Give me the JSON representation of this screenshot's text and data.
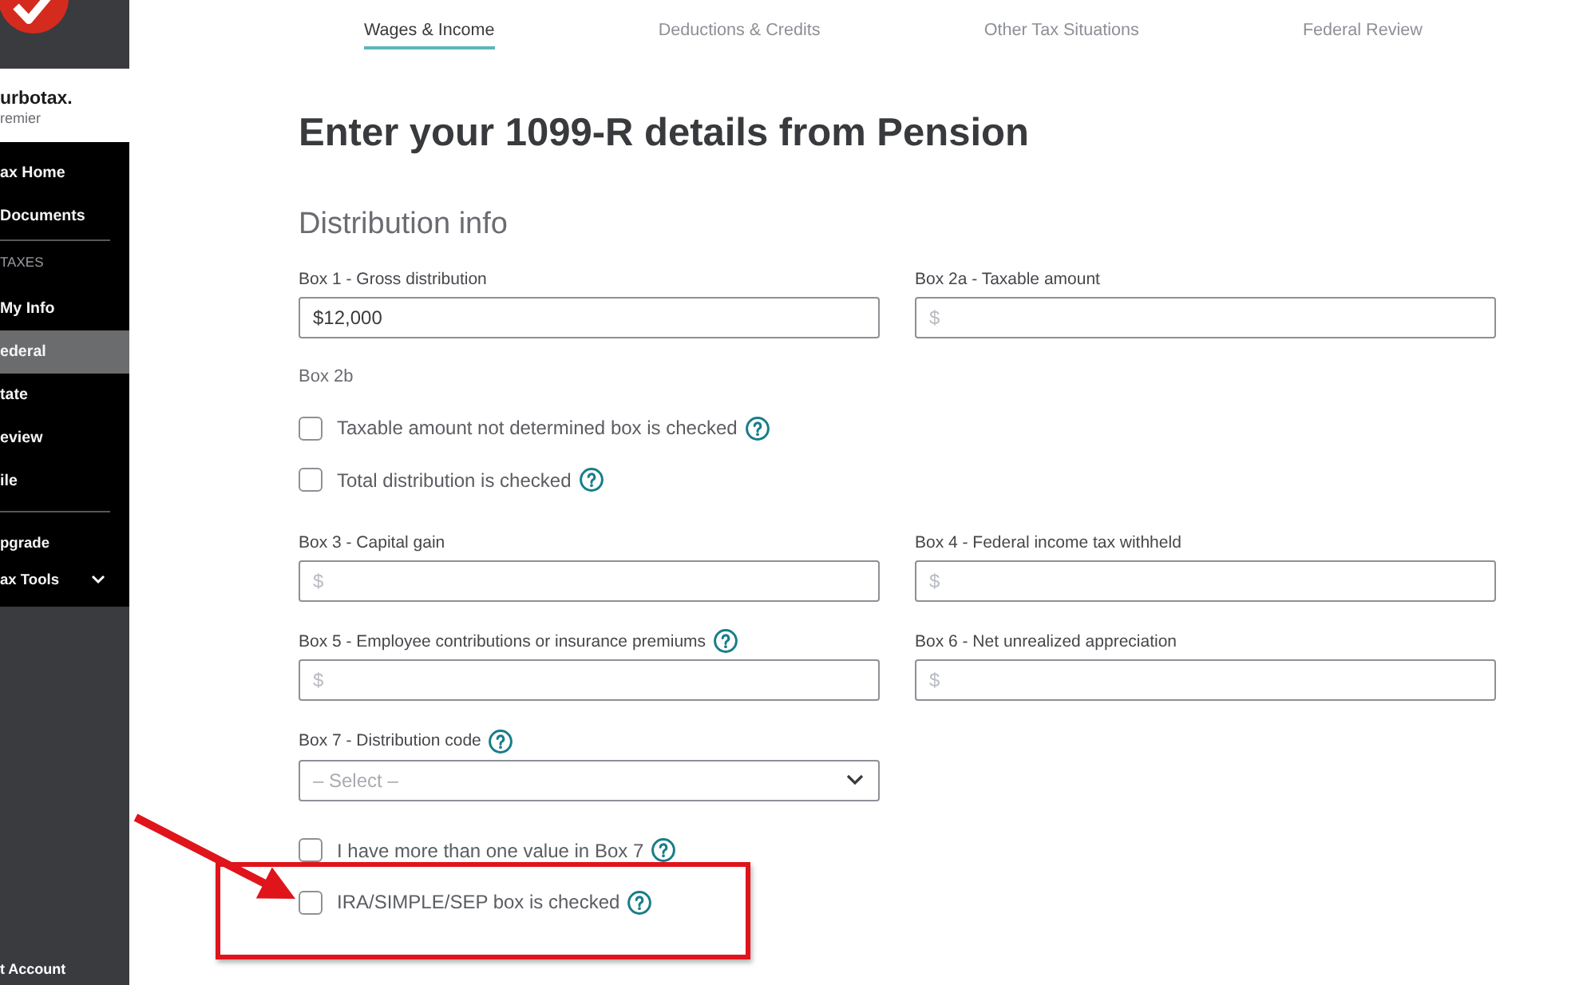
{
  "sidebar": {
    "logo": {
      "wordmark": "urbotax.",
      "edition": "remier"
    },
    "groups": [
      {
        "kind": "primary",
        "items": [
          {
            "label": "ax Home",
            "selected": false
          },
          {
            "label": "Documents",
            "selected": false
          }
        ]
      },
      {
        "kind": "primary",
        "header": "TAXES",
        "items": [
          {
            "label": "My Info",
            "selected": false
          },
          {
            "label": "ederal",
            "selected": true
          },
          {
            "label": "tate",
            "selected": false
          },
          {
            "label": "eview",
            "selected": false
          },
          {
            "label": "ile",
            "selected": false
          }
        ]
      },
      {
        "kind": "secondary",
        "items": [
          {
            "label": "pgrade",
            "selected": false
          },
          {
            "label": "ax Tools",
            "selected": false,
            "expanded": false
          }
        ]
      }
    ],
    "account": "t Account"
  },
  "tabs": [
    {
      "label": "Wages & Income",
      "selected": true
    },
    {
      "label": "Deductions & Credits",
      "selected": false
    },
    {
      "label": "Other Tax Situations",
      "selected": false
    },
    {
      "label": "Federal Review",
      "selected": false
    }
  ],
  "page": {
    "title": "Enter your 1099-R details from Pension",
    "section": "Distribution info"
  },
  "form": [
    {
      "kind": "fields",
      "fields": [
        {
          "kind": "text",
          "label": "Box 1 - Gross distribution",
          "value": "$12,000"
        },
        {
          "kind": "text",
          "label": "Box 2a - Taxable amount",
          "placeholder": "$"
        }
      ]
    },
    {
      "kind": "note",
      "text": "Box 2b"
    },
    {
      "kind": "checkbox",
      "label": "Taxable amount not determined box is checked",
      "checked": false,
      "help": true
    },
    {
      "kind": "checkbox",
      "label": "Total distribution is checked",
      "checked": false,
      "help": true
    },
    {
      "kind": "fields",
      "fields": [
        {
          "kind": "text",
          "label": "Box 3 - Capital gain",
          "placeholder": "$"
        },
        {
          "kind": "text",
          "label": "Box 4 - Federal income tax withheld",
          "placeholder": "$"
        }
      ]
    },
    {
      "kind": "fields",
      "fields": [
        {
          "kind": "text",
          "label": "Box 5 - Employee contributions or insurance premiums",
          "placeholder": "$",
          "help": true
        },
        {
          "kind": "text",
          "label": "Box 6 - Net unrealized appreciation",
          "placeholder": "$"
        }
      ]
    },
    {
      "kind": "fields",
      "fields": [
        {
          "kind": "select",
          "label": "Box 7 - Distribution code",
          "placeholder": "– Select –",
          "help": true
        }
      ]
    },
    {
      "kind": "checkbox",
      "label": "I have more than one value in Box 7",
      "checked": false,
      "help": true
    },
    {
      "kind": "checkbox",
      "label": "IRA/SIMPLE/SEP box is checked",
      "checked": false,
      "help": true
    }
  ],
  "annotations": {
    "arrow": true,
    "frame": true
  }
}
